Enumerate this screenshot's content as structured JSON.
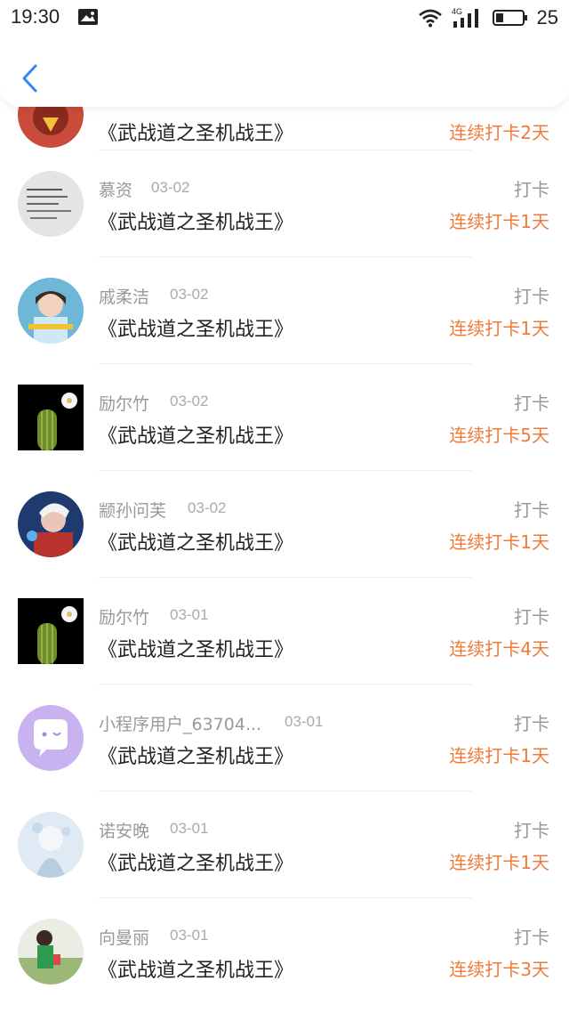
{
  "status_bar": {
    "time": "19:30",
    "network": "4G",
    "battery": "25",
    "icons": [
      "image-icon",
      "wifi-icon",
      "signal-icon",
      "battery-icon"
    ]
  },
  "header": {
    "back_icon": "chevron-left-icon"
  },
  "colors": {
    "accent": "#2b8af7",
    "streak": "#f07a3a",
    "muted": "#999999"
  },
  "records": [
    {
      "name": "",
      "date": "",
      "title": "《武战道之圣机战王》",
      "kind": "",
      "streak": "连续打卡2天"
    },
    {
      "name": "慕资",
      "date": "03-02",
      "title": "《武战道之圣机战王》",
      "kind": "打卡",
      "streak": "连续打卡1天"
    },
    {
      "name": "戚柔洁",
      "date": "03-02",
      "title": "《武战道之圣机战王》",
      "kind": "打卡",
      "streak": "连续打卡1天"
    },
    {
      "name": "励尔竹",
      "date": "03-02",
      "title": "《武战道之圣机战王》",
      "kind": "打卡",
      "streak": "连续打卡5天"
    },
    {
      "name": "颛孙问芙",
      "date": "03-02",
      "title": "《武战道之圣机战王》",
      "kind": "打卡",
      "streak": "连续打卡1天"
    },
    {
      "name": "励尔竹",
      "date": "03-01",
      "title": "《武战道之圣机战王》",
      "kind": "打卡",
      "streak": "连续打卡4天"
    },
    {
      "name": "小程序用户_63704...",
      "date": "03-01",
      "title": "《武战道之圣机战王》",
      "kind": "打卡",
      "streak": "连续打卡1天"
    },
    {
      "name": "诺安晚",
      "date": "03-01",
      "title": "《武战道之圣机战王》",
      "kind": "打卡",
      "streak": "连续打卡1天"
    },
    {
      "name": "向曼丽",
      "date": "03-01",
      "title": "《武战道之圣机战王》",
      "kind": "打卡",
      "streak": "连续打卡3天"
    }
  ]
}
